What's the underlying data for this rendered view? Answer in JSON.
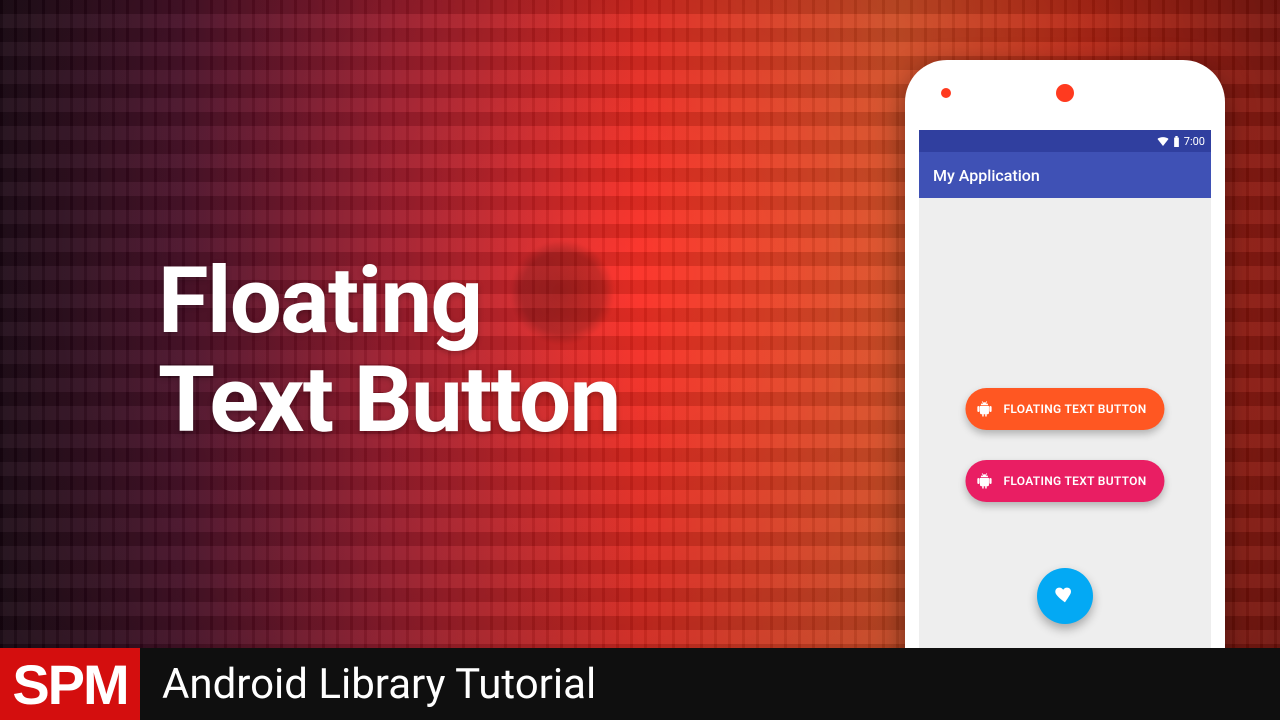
{
  "hero": {
    "title_line1": "Floating",
    "title_line2": "Text Button"
  },
  "footer": {
    "badge": "SPM",
    "subtitle": "Android Library Tutorial"
  },
  "phone": {
    "status_time": "7:00",
    "app_title": "My Application",
    "buttons": {
      "orange_label": "FLOATING TEXT BUTTON",
      "pink_label": "FLOATING TEXT BUTTON"
    }
  },
  "colors": {
    "accent_orange": "#ff5722",
    "accent_pink": "#e91e63",
    "fab_blue": "#03a9f4",
    "appbar": "#3f51b5"
  }
}
